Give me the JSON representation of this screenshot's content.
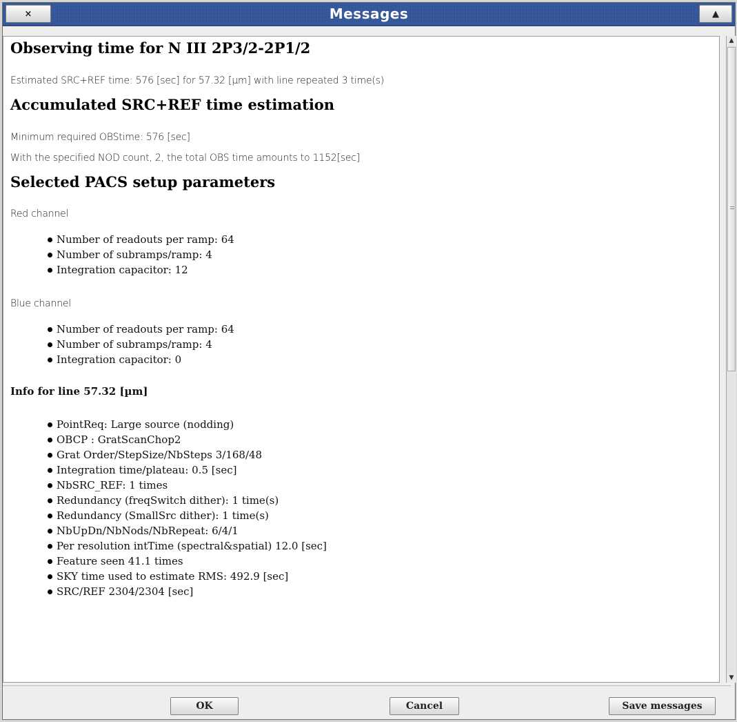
{
  "window": {
    "title": "Messages",
    "close_glyph": "×",
    "max_glyph": "▲"
  },
  "sections": {
    "obs_heading": "Observing time for N III 2P3/2-2P1/2",
    "obs_text": "Estimated SRC+REF time: 576 [sec] for 57.32 [µm] with line repeated 3 time(s)",
    "acc_heading": "Accumulated SRC+REF time estimation",
    "acc_min": "Minimum required OBStime: 576 [sec]",
    "acc_nod": "With the specified NOD count, 2, the total OBS time amounts to 1152[sec]",
    "pacs_heading": "Selected PACS setup parameters",
    "red_label": "Red channel",
    "red_items": [
      "Number of readouts per ramp: 64",
      "Number of subramps/ramp: 4",
      "Integration capacitor: 12"
    ],
    "blue_label": "Blue channel",
    "blue_items": [
      "Number of readouts per ramp: 64",
      "Number of subramps/ramp: 4",
      "Integration capacitor: 0"
    ],
    "info_heading": "Info for line 57.32 [µm]",
    "info_items": [
      "PointReq: Large source (nodding)",
      "OBCP : GratScanChop2",
      "Grat Order/StepSize/NbSteps 3/168/48",
      "Integration time/plateau: 0.5 [sec]",
      "NbSRC_REF: 1 times",
      "Redundancy (freqSwitch dither): 1 time(s)",
      "Redundancy (SmallSrc dither): 1 time(s)",
      "NbUpDn/NbNods/NbRepeat: 6/4/1",
      "Per resolution intTime (spectral&spatial) 12.0 [sec]",
      "Feature seen 41.1 times",
      "SKY time used to estimate RMS: 492.9 [sec]",
      "SRC/REF 2304/2304 [sec]"
    ]
  },
  "buttons": {
    "ok": "OK",
    "cancel": "Cancel",
    "save": "Save messages"
  }
}
